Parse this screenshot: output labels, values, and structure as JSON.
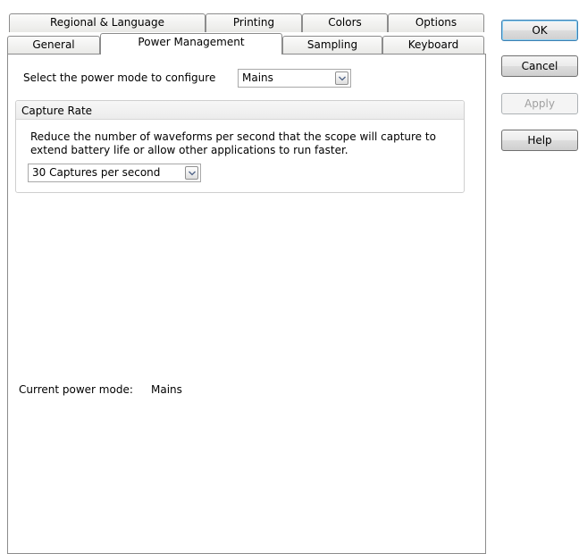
{
  "tabs_row_top": [
    {
      "label": "Regional & Language"
    },
    {
      "label": "Printing"
    },
    {
      "label": "Colors"
    },
    {
      "label": "Options"
    }
  ],
  "tabs_row_bottom": [
    {
      "label": "General"
    },
    {
      "label": "Power Management",
      "active": true
    },
    {
      "label": "Sampling"
    },
    {
      "label": "Keyboard"
    }
  ],
  "power_mode": {
    "label": "Select the power mode to configure",
    "value": "Mains"
  },
  "capture_rate": {
    "title": "Capture Rate",
    "description_line1": "Reduce the number of waveforms per second that the scope will capture to",
    "description_line2": "extend battery life or allow other applications to run faster.",
    "value": "30 Captures per second"
  },
  "status": {
    "label": "Current power mode:",
    "value": "Mains"
  },
  "buttons": {
    "ok": "OK",
    "cancel": "Cancel",
    "apply": "Apply",
    "help": "Help"
  },
  "icons": {
    "dropdown": "chevron-down-icon",
    "cursor": "mouse-pointer-icon"
  }
}
